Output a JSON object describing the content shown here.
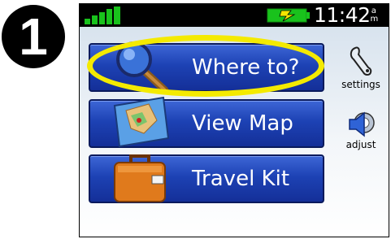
{
  "step_badge": "1",
  "status_bar": {
    "clock_time": "11:42",
    "clock_ampm": "a\nm",
    "signal_icon": "satellite-signal-bars-icon",
    "battery_icon": "battery-charging-icon"
  },
  "main_menu": {
    "where_to": {
      "label": "Where to?",
      "icon": "magnifier-icon"
    },
    "view_map": {
      "label": "View Map",
      "icon": "map-icon"
    },
    "travel_kit": {
      "label": "Travel Kit",
      "icon": "suitcase-icon"
    }
  },
  "side_menu": {
    "settings": {
      "label": "settings",
      "icon": "wrench-icon"
    },
    "adjust": {
      "label": "adjust",
      "icon": "speaker-volume-icon"
    }
  },
  "colors": {
    "button_blue": "#1d42b4",
    "highlight_yellow": "#f4ea00",
    "status_bar": "#000000",
    "signal_green": "#19c21c"
  }
}
